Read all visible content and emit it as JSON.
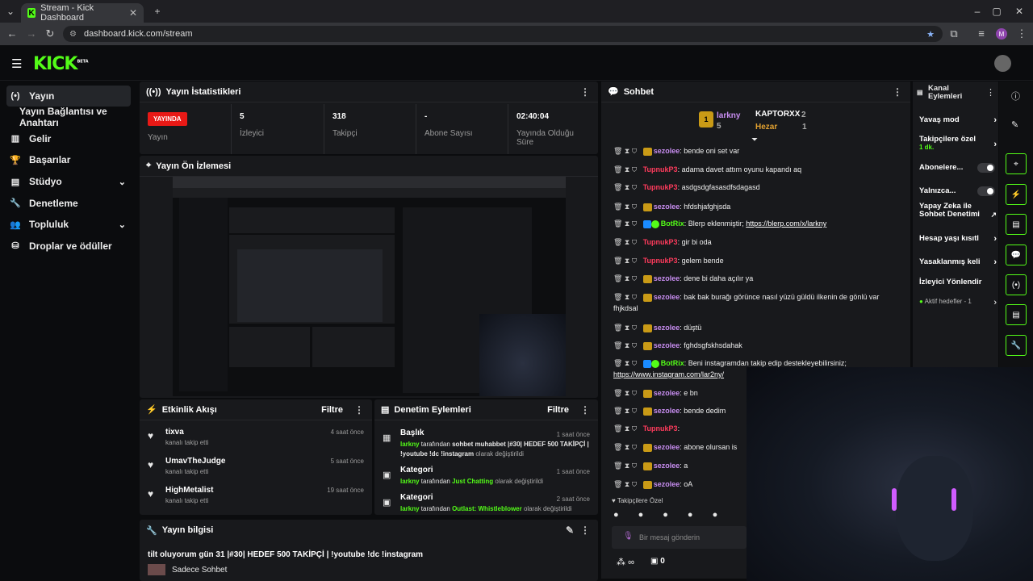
{
  "browser": {
    "tab_title": "Stream - Kick Dashboard",
    "url": "dashboard.kick.com/stream",
    "profile_initial": "M"
  },
  "logo": {
    "text": "KICK",
    "badge": "BETA"
  },
  "sidebar": {
    "items": [
      {
        "label": "Yayın",
        "icon": "broadcast-icon"
      },
      {
        "label": "Yayın Bağlantısı ve Anahtarı",
        "icon": ""
      },
      {
        "label": "Gelir",
        "icon": "chart-icon"
      },
      {
        "label": "Başarılar",
        "icon": "trophy-icon"
      },
      {
        "label": "Stüdyo",
        "icon": "video-icon"
      },
      {
        "label": "Denetleme",
        "icon": "wrench-icon"
      },
      {
        "label": "Topluluk",
        "icon": "people-icon"
      },
      {
        "label": "Droplar ve ödüller",
        "icon": "gift-icon"
      }
    ]
  },
  "stats": {
    "title": "Yayın İstatistikleri",
    "live_badge": "YAYINDA",
    "live_label": "Yayın",
    "viewers": "5",
    "viewers_label": "İzleyici",
    "followers": "318",
    "followers_label": "Takipçi",
    "subs": "-",
    "subs_label": "Abone Sayısı",
    "duration": "02:40:04",
    "duration_label": "Yayında Olduğu Süre"
  },
  "preview": {
    "title": "Yayın Ön İzlemesi"
  },
  "activity": {
    "title": "Etkinlik Akışı",
    "filter": "Filtre",
    "items": [
      {
        "name": "tixva",
        "sub": "kanalı takip etti",
        "time": "4 saat önce"
      },
      {
        "name": "UmavTheJudge",
        "sub": "kanalı takip etti",
        "time": "5 saat önce"
      },
      {
        "name": "HighMetalist",
        "sub": "kanalı takip etti",
        "time": "19 saat önce"
      }
    ]
  },
  "moderation": {
    "title": "Denetim Eylemleri",
    "filter": "Filtre",
    "items": [
      {
        "head": "Başlık",
        "time": "1 saat önce",
        "user": "larkny",
        "mid": " tarafından ",
        "value": "sohbet muhabbet |#30| HEDEF 500 TAKİPÇİ | !youtube !dc !instagram",
        "tail": " olarak değiştirildi"
      },
      {
        "head": "Kategori",
        "time": "1 saat önce",
        "user": "larkny",
        "mid": " tarafından ",
        "value": "Just Chatting",
        "tail": " olarak değiştirildi"
      },
      {
        "head": "Kategori",
        "time": "2 saat önce",
        "user": "larkny",
        "mid": " tarafından ",
        "value": "Outlast: Whistleblower",
        "tail": " olarak değiştirildi"
      }
    ]
  },
  "stream_info": {
    "title": "Yayın bilgisi",
    "stream_title": "tilt oluyorum gün 31 |#30| HEDEF 500 TAKİPÇİ | !youtube !dc !instagram",
    "category": "Sadece Sohbet"
  },
  "chat": {
    "title": "Sohbet",
    "leaderboard": [
      {
        "rank": "1",
        "name": "larkny",
        "count": "5"
      },
      {
        "name": "KAPTORXX",
        "count": "2"
      },
      {
        "name": "Hezar",
        "count": "1"
      }
    ],
    "messages": [
      {
        "user": "sezolee",
        "text": ": bende oni set var",
        "type": "gold"
      },
      {
        "user": "TupnukP3",
        "text": ": adama davet attım oyunu kapandı aq",
        "type": "pink"
      },
      {
        "user": "TupnukP3",
        "text": ": asdgsdgfasasdfsdagasd",
        "type": "pink"
      },
      {
        "user": "sezolee",
        "text": ": hfdshjafghjsda",
        "type": "gold"
      },
      {
        "user": "BotRix",
        "text": ": Blerp eklenmiştir; ",
        "link": "https://blerp.com/x/larkny",
        "type": "bot"
      },
      {
        "user": "TupnukP3",
        "text": ": gir bi oda",
        "type": "pink"
      },
      {
        "user": "TupnukP3",
        "text": ": gelem bende",
        "type": "pink"
      },
      {
        "user": "sezolee",
        "text": ": dene bi daha açılır ya",
        "type": "gold"
      },
      {
        "user": "sezolee",
        "text": ": bak bak burağı görünce nasıl yüzü güldü ilkenin de gönlü var fhjkdsal",
        "type": "gold"
      },
      {
        "user": "sezolee",
        "text": ": düştü",
        "type": "gold"
      },
      {
        "user": "sezolee",
        "text": ": fghdsgfskhsdahak",
        "type": "gold"
      },
      {
        "user": "BotRix",
        "text": ": Beni instagramdan takip edip destekleyebilirsiniz; ",
        "link": "https://www.instagram.com/lar2ny/",
        "type": "bot"
      },
      {
        "user": "sezolee",
        "text": ": e bn",
        "type": "gold"
      },
      {
        "user": "sezolee",
        "text": ": bende dedim",
        "type": "gold"
      },
      {
        "user": "TupnukP3",
        "text": ":",
        "type": "pink"
      },
      {
        "user": "sezolee",
        "text": ": abone olursan is",
        "type": "gold"
      },
      {
        "user": "sezolee",
        "text": ": a",
        "type": "gold"
      },
      {
        "user": "sezolee",
        "text": ": oA",
        "type": "gold"
      }
    ],
    "followers_only_label": "Takipçilere Özel",
    "input_placeholder": "Bir mesaj gönderin",
    "infinity": "∞",
    "gift_count": "0"
  },
  "channel_actions": {
    "title": "Kanal Eylemleri",
    "items": [
      {
        "label": "Yavaş mod",
        "kind": "arrow"
      },
      {
        "label": "Takipçilere özel",
        "sub": "1 dk.",
        "kind": "arrow"
      },
      {
        "label": "Abonelere...",
        "kind": "toggle"
      },
      {
        "label": "Yalnızca...",
        "kind": "toggle"
      },
      {
        "label": "Yapay Zeka ile Sohbet Denetimi",
        "kind": "external"
      },
      {
        "label": "Hesap yaşı kısıtl",
        "kind": "arrow"
      },
      {
        "label": "Yasaklanmış keli",
        "kind": "arrow"
      },
      {
        "label": "İzleyici Yönlendir",
        "kind": "none"
      },
      {
        "label": "Aktif hedefler - 1",
        "kind": "arrow"
      }
    ]
  }
}
